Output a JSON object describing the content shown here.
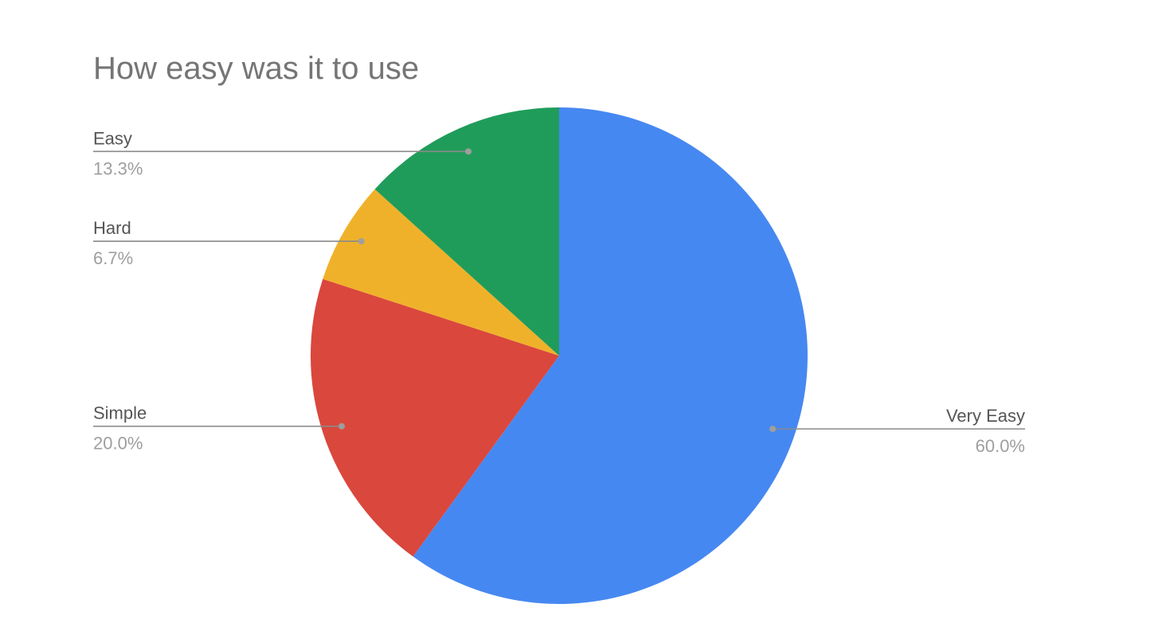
{
  "chart_data": {
    "type": "pie",
    "title": "How easy was it to use",
    "start_angle_deg": 0,
    "direction": "clockwise",
    "slices": [
      {
        "label": "Very Easy",
        "value": 60.0,
        "pct_label": "60.0%",
        "color": "#4688F1"
      },
      {
        "label": "Simple",
        "value": 20.0,
        "pct_label": "20.0%",
        "color": "#DA473D"
      },
      {
        "label": "Hard",
        "value": 6.7,
        "pct_label": "6.7%",
        "color": "#F0B12A"
      },
      {
        "label": "Easy",
        "value": 13.3,
        "pct_label": "13.3%",
        "color": "#209C5A"
      }
    ],
    "legend": "labeled slices with leader lines"
  }
}
